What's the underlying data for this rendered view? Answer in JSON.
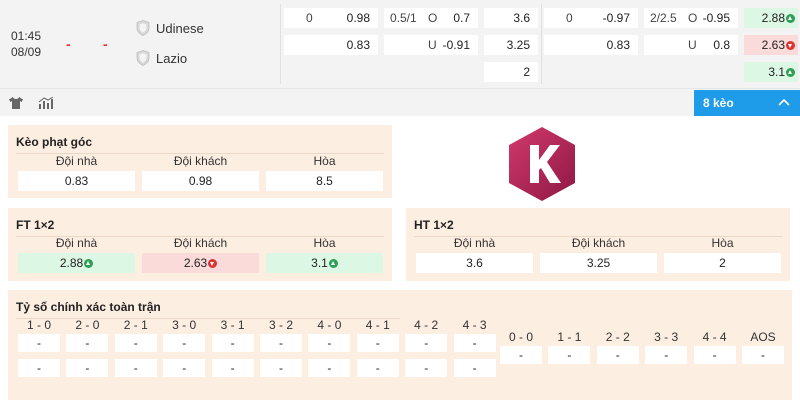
{
  "match": {
    "time": "01:45",
    "date": "08/09",
    "home_score": "-",
    "away_score": "-",
    "home_team": "Udinese",
    "away_team": "Lazio"
  },
  "odds": {
    "r1": {
      "h_line": "0",
      "h_val": "0.98",
      "ou_line": "0.5/1",
      "ou_tag": "O",
      "ou_val": "0.7",
      "x1": "3.6",
      "h2_line": "0",
      "h2_val": "-0.97",
      "ou2_line": "2/2.5",
      "ou2_tag": "O",
      "ou2_val": "-0.95",
      "last": "2.88"
    },
    "r2": {
      "h_val": "0.83",
      "ou_tag": "U",
      "ou_val": "-0.91",
      "x1": "3.25",
      "h2_val": "0.83",
      "ou2_tag": "U",
      "ou2_val": "0.8",
      "last": "2.63"
    },
    "r3": {
      "x1": "2",
      "last": "3.1"
    }
  },
  "toolbar": {
    "keo_label": "8 kèo"
  },
  "corner": {
    "title": "Kèo phạt góc",
    "labels": [
      "Đội nhà",
      "Đội khách",
      "Hòa"
    ],
    "values": [
      "0.83",
      "0.98",
      "8.5"
    ]
  },
  "ft": {
    "title": "FT 1×2",
    "labels": [
      "Đội nhà",
      "Đội khách",
      "Hòa"
    ],
    "values": [
      "2.88",
      "2.63",
      "3.1"
    ]
  },
  "ht": {
    "title": "HT 1×2",
    "labels": [
      "Đội nhà",
      "Đội khách",
      "Hòa"
    ],
    "values": [
      "3.6",
      "3.25",
      "2"
    ]
  },
  "exact": {
    "title": "Tỷ số chính xác toàn trận",
    "left_headers": [
      "1 - 0",
      "2 - 0",
      "2 - 1",
      "3 - 0",
      "3 - 1",
      "3 - 2",
      "4 - 0",
      "4 - 1",
      "4 - 2",
      "4 - 3"
    ],
    "left_row1": [
      "-",
      "-",
      "-",
      "-",
      "-",
      "-",
      "-",
      "-",
      "-",
      "-"
    ],
    "left_row2": [
      "-",
      "-",
      "-",
      "-",
      "-",
      "-",
      "-",
      "-",
      "-",
      "-"
    ],
    "right_headers": [
      "0 - 0",
      "1 - 1",
      "2 - 2",
      "3 - 3",
      "4 - 4",
      "AOS"
    ],
    "right_row1": [
      "-",
      "-",
      "-",
      "-",
      "-",
      "-"
    ]
  },
  "colors": {
    "accent": "#1e9be9",
    "up": "#2e9e58",
    "down": "#dd3333",
    "box_bg": "#fdeee2",
    "logo": "#b0245a"
  }
}
